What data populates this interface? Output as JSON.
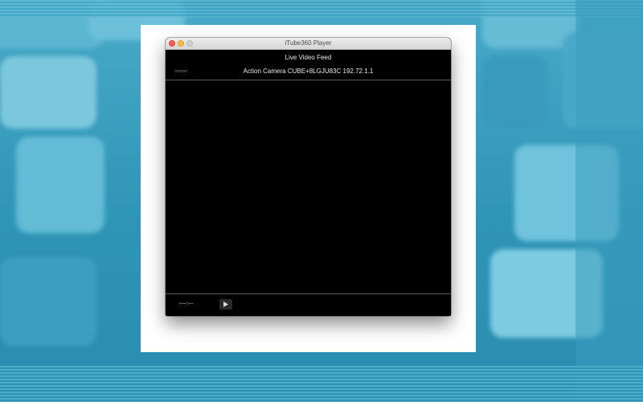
{
  "window": {
    "title": "iTube360 Player",
    "controls": [
      "close",
      "minimize",
      "zoom"
    ]
  },
  "feed": {
    "heading": "Live Video Feed",
    "status_dots": "○○○○○",
    "camera_label": "Action Camera CUBE+8LGJU83C 192.72.1.1"
  },
  "playback": {
    "progress_text": "‹—○—",
    "play_icon": "play-icon"
  },
  "colors": {
    "window_bg": "#000000",
    "text": "#e8e8e8",
    "close": "#fc605c",
    "minimize": "#fdbc40",
    "desktop": "#3a9fbe"
  }
}
